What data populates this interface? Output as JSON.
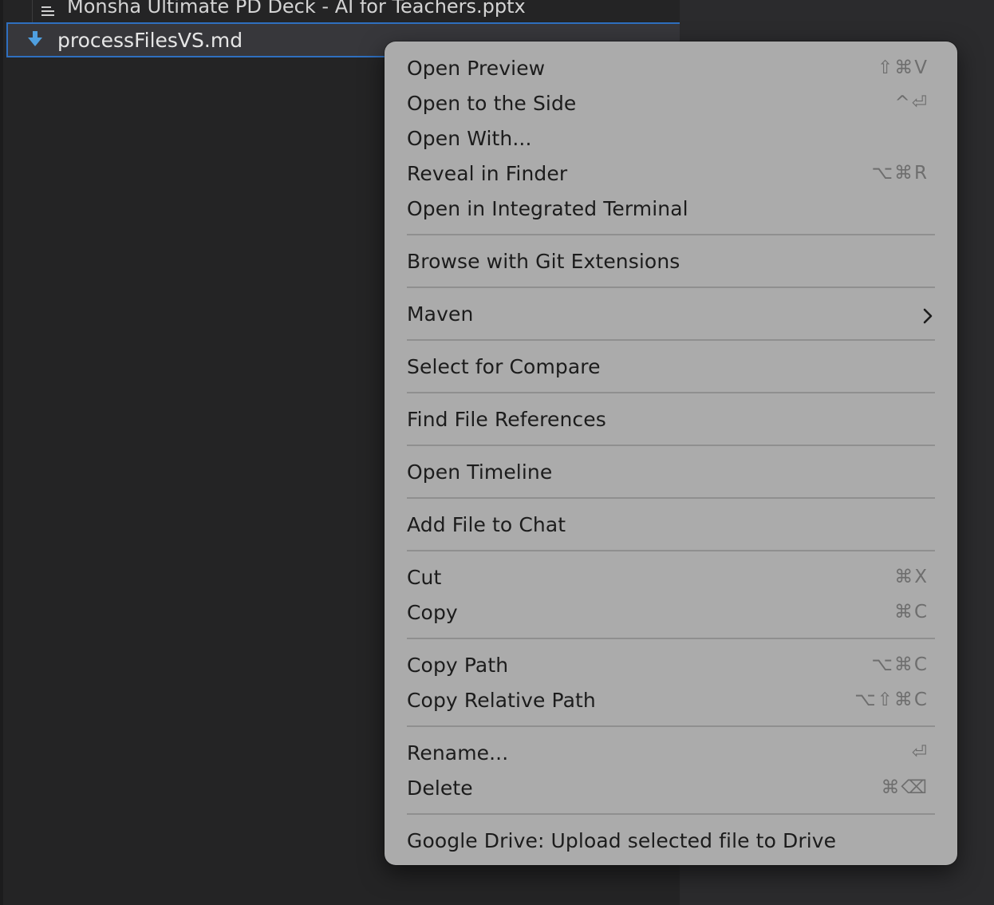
{
  "explorer": {
    "prev_row_label": "Monsha Ultimate PD Deck - AI for Teachers.pptx",
    "selected_row_label": "processFilesVS.md",
    "md_icon_color": "#4f9fe0",
    "selection_border_color": "#2f6fbf"
  },
  "menu": {
    "open_preview": {
      "label": "Open Preview",
      "shortcut": "⇧⌘V"
    },
    "open_to_side": {
      "label": "Open to the Side",
      "shortcut": "^⏎"
    },
    "open_with": {
      "label": "Open With..."
    },
    "reveal_finder": {
      "label": "Reveal in Finder",
      "shortcut": "⌥⌘R"
    },
    "open_terminal": {
      "label": "Open in Integrated Terminal"
    },
    "browse_git": {
      "label": "Browse with Git Extensions"
    },
    "maven": {
      "label": "Maven"
    },
    "select_compare": {
      "label": "Select for Compare"
    },
    "find_refs": {
      "label": "Find File References"
    },
    "open_timeline": {
      "label": "Open Timeline"
    },
    "add_chat": {
      "label": "Add File to Chat"
    },
    "cut": {
      "label": "Cut",
      "shortcut": "⌘X"
    },
    "copy": {
      "label": "Copy",
      "shortcut": "⌘C"
    },
    "copy_path": {
      "label": "Copy Path",
      "shortcut": "⌥⌘C"
    },
    "copy_rel_path": {
      "label": "Copy Relative Path",
      "shortcut": "⌥⇧⌘C"
    },
    "rename": {
      "label": "Rename...",
      "shortcut": "⏎"
    },
    "delete": {
      "label": "Delete",
      "shortcut": "⌘⌫"
    },
    "gdrive": {
      "label": "Google Drive: Upload selected file to Drive"
    }
  }
}
